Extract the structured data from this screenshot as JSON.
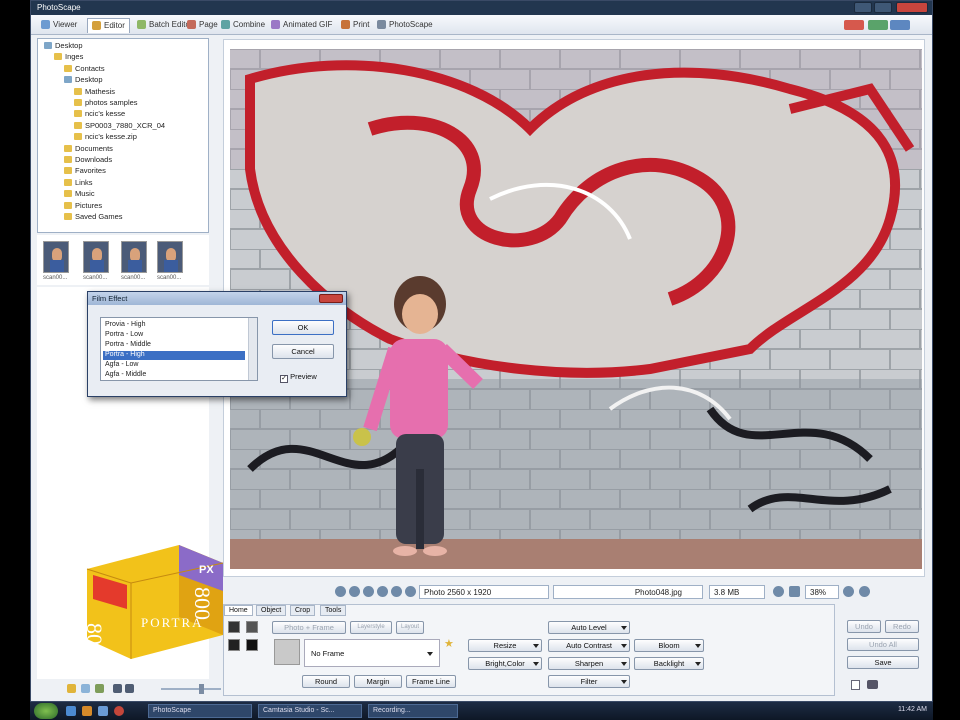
{
  "window": {
    "title": "PhotoScape"
  },
  "tabs": [
    {
      "label": "Viewer",
      "color": "#6d9bd1"
    },
    {
      "label": "Editor",
      "color": "#d4a03c",
      "active": true
    },
    {
      "label": "Batch Editor",
      "color": "#8fb867"
    },
    {
      "label": "Page",
      "color": "#c46a5a"
    },
    {
      "label": "Combine",
      "color": "#5fa3a3"
    },
    {
      "label": "Animated GIF",
      "color": "#9b78c6"
    },
    {
      "label": "Print",
      "color": "#c7733a"
    },
    {
      "label": "PhotoScape",
      "color": "#7a8a9e"
    }
  ],
  "tree": [
    {
      "label": "Desktop",
      "level": 0,
      "icon": "folder-blue-icon"
    },
    {
      "label": "Inges",
      "level": 1,
      "icon": "folder-icon"
    },
    {
      "label": "Contacts",
      "level": 2,
      "icon": "folder-icon"
    },
    {
      "label": "Desktop",
      "level": 2,
      "icon": "folder-blue-icon"
    },
    {
      "label": "Mathesis",
      "level": 3,
      "icon": "folder-icon"
    },
    {
      "label": "photos samples",
      "level": 3,
      "icon": "folder-icon"
    },
    {
      "label": "ncic's kesse",
      "level": 3,
      "icon": "folder-icon"
    },
    {
      "label": "SP0003_7880_XCR_04",
      "level": 3,
      "icon": "folder-icon"
    },
    {
      "label": "ncic's kesse.zip",
      "level": 3,
      "icon": "folder-icon"
    },
    {
      "label": "Documents",
      "level": 2,
      "icon": "folder-icon"
    },
    {
      "label": "Downloads",
      "level": 2,
      "icon": "folder-icon"
    },
    {
      "label": "Favorites",
      "level": 2,
      "icon": "folder-icon"
    },
    {
      "label": "Links",
      "level": 2,
      "icon": "folder-icon"
    },
    {
      "label": "Music",
      "level": 2,
      "icon": "folder-icon"
    },
    {
      "label": "Pictures",
      "level": 2,
      "icon": "folder-icon"
    },
    {
      "label": "Saved Games",
      "level": 2,
      "icon": "folder-icon"
    }
  ],
  "thumbnails": [
    "scan00...",
    "scan00...",
    "scan00...",
    "scan00..."
  ],
  "dialog": {
    "title": "Film Effect",
    "items": [
      "Provia - High",
      "Portra - Low",
      "Portra - Middle",
      "Portra - High",
      "Agfa - Low",
      "Agfa - Middle"
    ],
    "selected_index": 3,
    "ok_label": "OK",
    "cancel_label": "Cancel",
    "preview_label": "Preview",
    "preview_checked": true
  },
  "status": {
    "photo_size": "Photo 2560 x 1920",
    "filename": "Photo048.jpg",
    "filesize": "3.8 MB",
    "zoom": "38%"
  },
  "edit_tabs": [
    "Home",
    "Object",
    "Crop",
    "Tools"
  ],
  "frame": {
    "photo_frame_label": "Photo + Frame",
    "tab2": "Layerstyle",
    "tab3": "Layout",
    "selected_frame": "No Frame",
    "round_label": "Round",
    "margin_label": "Margin",
    "frame_line_label": "Frame Line"
  },
  "tools": {
    "resize": "Resize",
    "bright_color": "Bright,Color",
    "auto_level": "Auto Level",
    "auto_contrast": "Auto Contrast",
    "sharpen": "Sharpen",
    "filter": "Filter",
    "bloom": "Bloom",
    "backlight": "Backlight"
  },
  "actions": {
    "undo": "Undo",
    "redo": "Redo",
    "undo_all": "Undo All",
    "save": "Save"
  },
  "kodak": {
    "brand": "PX",
    "iso": "800",
    "name": "PORTRA"
  },
  "taskbar": [
    "PhotoScape",
    "Camtasia Studio - Sc...",
    "Recording..."
  ],
  "clock": "11:42 AM"
}
